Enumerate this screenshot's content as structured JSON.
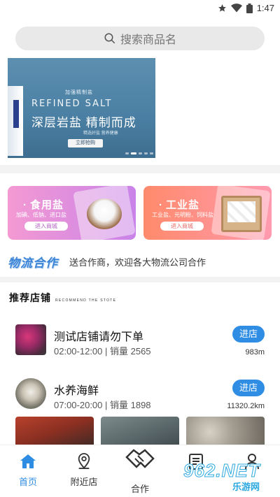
{
  "status_bar": {
    "time": "1:47"
  },
  "search": {
    "placeholder": "搜索商品名"
  },
  "banner": {
    "top_text": "加强精制盐",
    "english": "REFINED SALT",
    "headline": "深层岩盐 精制而成",
    "small_text": "精选好盐 营养健康",
    "button": "立即抢购"
  },
  "categories": [
    {
      "title": "食用盐",
      "subtitle": "加碘、低钠、进口盐",
      "button": "进入商城"
    },
    {
      "title": "工业盐",
      "subtitle": "工业盐、元明粉、饲料盐",
      "button": "进入商城"
    }
  ],
  "logistics": {
    "title": "物流合作",
    "text": "送合作商，欢迎各大物流公司合作"
  },
  "recommend": {
    "title": "推荐店铺",
    "subtitle": "RECOMMEND THE STOTE"
  },
  "shops": [
    {
      "name": "测试店铺请勿下单",
      "meta": "02:00-12:00 | 销量 2565",
      "button": "进店",
      "distance": "983m"
    },
    {
      "name": "水养海鲜",
      "meta": "07:00-20:00 | 销量 1898",
      "button": "进店",
      "distance": "11320.2km"
    }
  ],
  "tabs": [
    {
      "label": "首页",
      "icon": "home-icon"
    },
    {
      "label": "附近店",
      "icon": "location-pin-icon"
    },
    {
      "label": "合作",
      "icon": "handshake-icon"
    },
    {
      "label": "",
      "icon": "order-list-icon"
    },
    {
      "label": "",
      "icon": "user-icon"
    }
  ],
  "watermark": {
    "text": "962.NET",
    "subtext": "乐游网"
  },
  "colors": {
    "accent": "#2f8de4",
    "logistics_title": "#3d84d6"
  }
}
